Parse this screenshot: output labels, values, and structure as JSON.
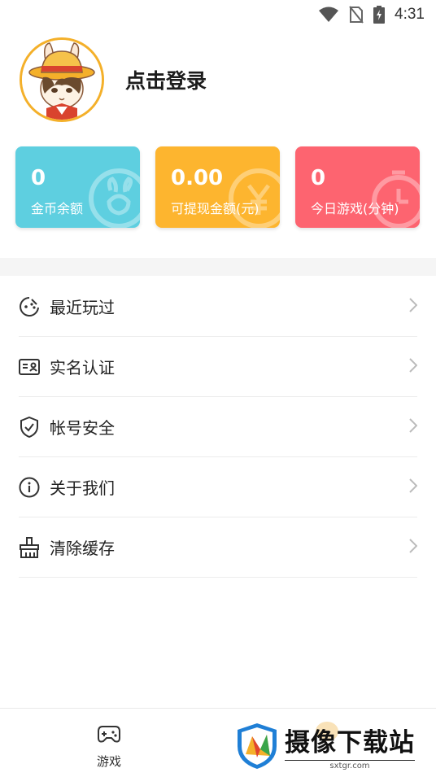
{
  "status_bar": {
    "time": "4:31"
  },
  "profile": {
    "login_label": "点击登录"
  },
  "cards": [
    {
      "value": "0",
      "label": "金币余额",
      "color": "#5ecfe0"
    },
    {
      "value": "0.00",
      "label": "可提现金额(元)",
      "color": "#fdb52f"
    },
    {
      "value": "0",
      "label": "今日游戏(分钟)",
      "color": "#fd6470"
    }
  ],
  "menu": {
    "items": [
      {
        "label": "最近玩过",
        "icon": "gamepad-recent-icon"
      },
      {
        "label": "实名认证",
        "icon": "id-card-icon"
      },
      {
        "label": "帐号安全",
        "icon": "shield-check-icon"
      },
      {
        "label": "关于我们",
        "icon": "info-icon"
      },
      {
        "label": "清除缓存",
        "icon": "broom-icon"
      }
    ]
  },
  "bottom_nav": {
    "game_label": "游戏"
  },
  "watermark": {
    "text": "摄像下载站",
    "url": "sxtgr.com"
  }
}
